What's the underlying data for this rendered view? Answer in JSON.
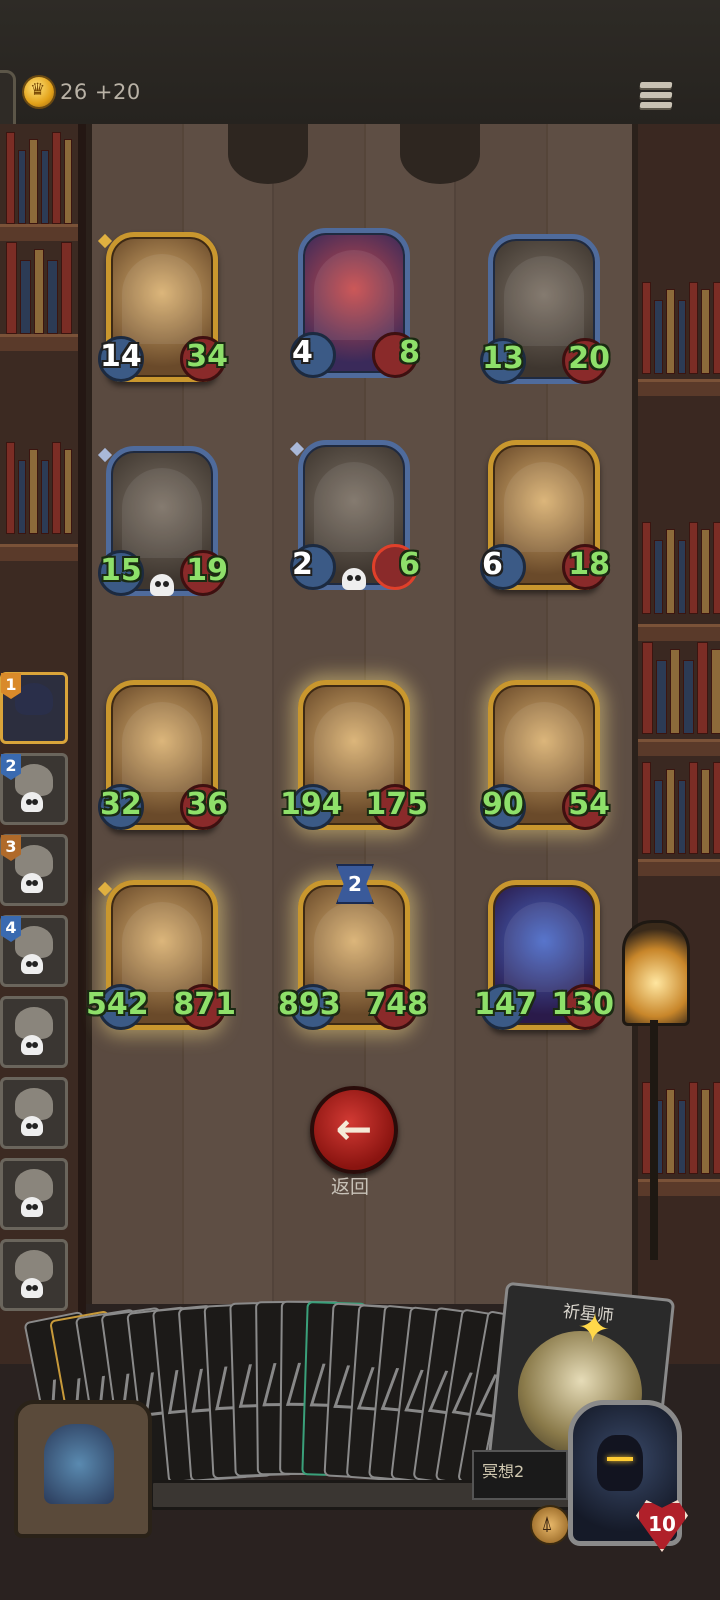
{
  "header": {
    "coins_text": "26 +20",
    "coin_icon": "crown-coin-icon",
    "menu_icon": "hamburger-menu-icon"
  },
  "board": {
    "enemy_row1": [
      {
        "name": "ship-kraken-minion",
        "attack": "14",
        "health": "34",
        "frame": "gold",
        "attack_color": "white"
      },
      {
        "name": "clown-minion",
        "attack": "4",
        "health": "8",
        "frame": "blue",
        "attack_color": "white"
      },
      {
        "name": "skull-demon-minion",
        "attack": "13",
        "health": "20",
        "frame": "blue",
        "attack_color": "green"
      }
    ],
    "enemy_row2": [
      {
        "name": "bone-beast-minion",
        "attack": "15",
        "health": "19",
        "frame": "blue",
        "attack_color": "green"
      },
      {
        "name": "pinocchio-minion",
        "attack": "2",
        "health": "6",
        "frame": "blue",
        "attack_color": "white"
      },
      {
        "name": "airship-minion",
        "attack": "6",
        "health": "18",
        "frame": "gold",
        "attack_color": "white"
      }
    ],
    "player_row1": [
      {
        "name": "sea-priestess-minion",
        "attack": "32",
        "health": "36"
      },
      {
        "name": "sea-king-minion",
        "attack": "194",
        "health": "175"
      },
      {
        "name": "sea-priestess-minion-2",
        "attack": "90",
        "health": "54"
      }
    ],
    "player_row2": [
      {
        "name": "blonde-mage-minion",
        "attack": "542",
        "health": "871"
      },
      {
        "name": "ghost-horse-minion",
        "attack": "893",
        "health": "748",
        "tier": "2"
      },
      {
        "name": "star-sorceress-minion",
        "attack": "147",
        "health": "130"
      }
    ]
  },
  "tavern_list": [
    {
      "rank": "1",
      "active": true
    },
    {
      "rank": "2",
      "active": false
    },
    {
      "rank": "3",
      "active": false
    },
    {
      "rank": "4",
      "active": false
    },
    {
      "rank": "",
      "active": false
    },
    {
      "rank": "",
      "active": false
    },
    {
      "rank": "",
      "active": false
    },
    {
      "rank": "",
      "active": false
    }
  ],
  "back_button": {
    "label": "返回",
    "icon": "arrow-left-icon"
  },
  "hand": {
    "card_count": 20,
    "featured_card_title": "祈星师",
    "meditate_text": "冥想2"
  },
  "hero": {
    "health": "10"
  },
  "colors": {
    "stat_green": "#8ee06a",
    "stat_white": "#ffffff",
    "gold_frame": "#c9972e",
    "blue_frame": "#4f6b9c",
    "back_button": "#b8231e"
  }
}
